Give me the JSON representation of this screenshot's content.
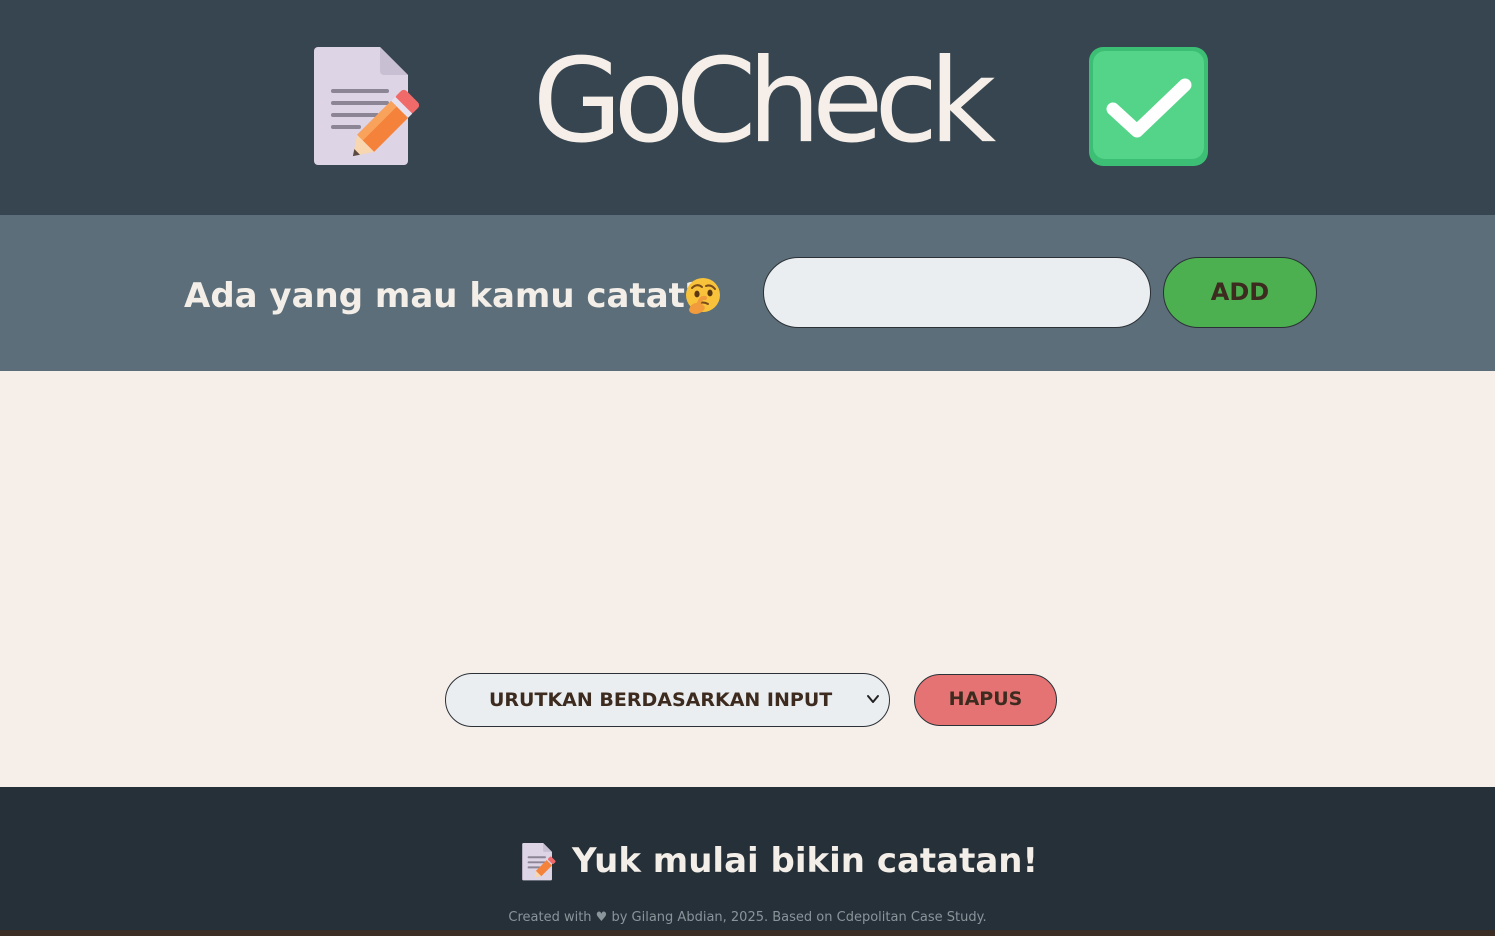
{
  "header": {
    "title": "GoCheck",
    "left_icon": "memo-icon",
    "right_icon": "check-mark-button-icon"
  },
  "input_bar": {
    "prompt": "Ada yang mau kamu catat?",
    "prompt_icon": "thinking-face-icon",
    "input_value": "",
    "input_placeholder": "",
    "add_label": "ADD"
  },
  "controls": {
    "sort_selected": "URUTKAN BERDASARKAN INPUT",
    "delete_label": "HAPUS"
  },
  "footer": {
    "message": "Yuk mulai bikin catatan!",
    "message_icon": "memo-icon",
    "credit": "Created with ♥ by Gilang Abdian, 2025. Based on Cdepolitan Case Study."
  },
  "colors": {
    "header_bg": "#36454f",
    "input_bar_bg": "#5c6e79",
    "main_bg": "#f6efe9",
    "footer_bg": "#263038",
    "add_button": "#4caf50",
    "delete_button": "#e57373",
    "title_text": "#f6efe9"
  }
}
